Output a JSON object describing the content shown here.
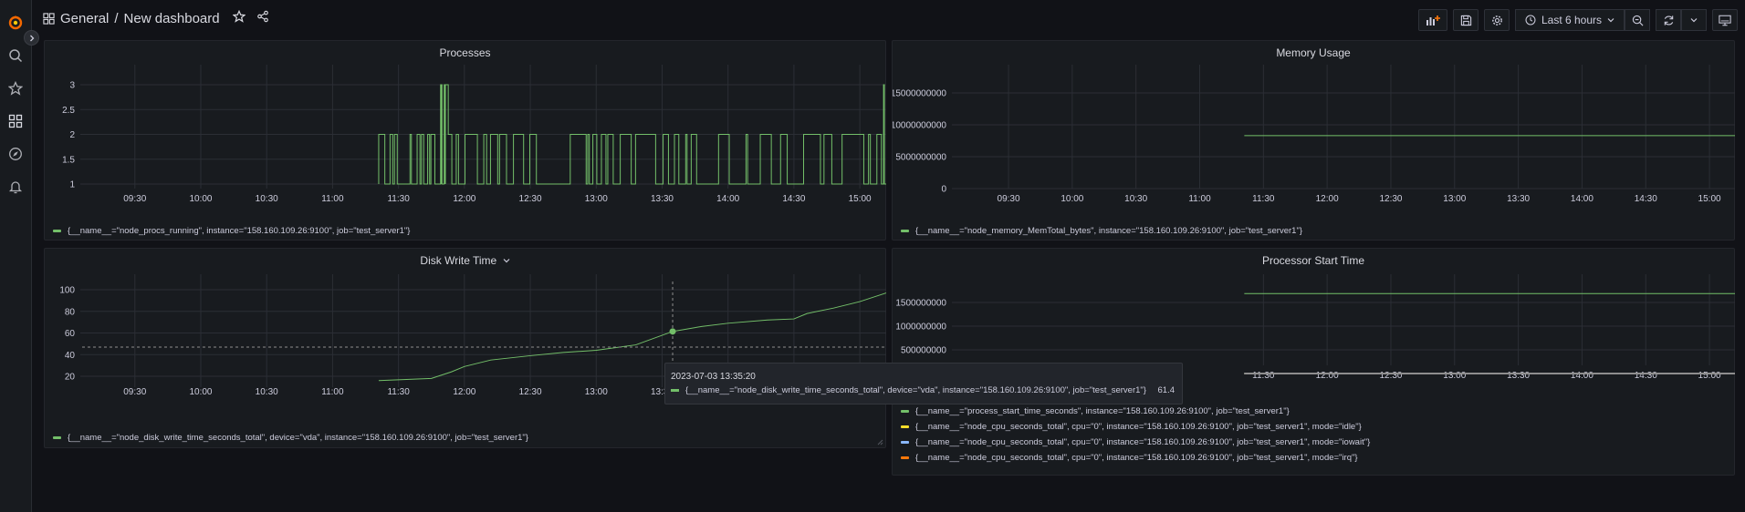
{
  "breadcrumb": {
    "folder": "General",
    "separator": "/",
    "title": "New dashboard"
  },
  "toolbar": {
    "time_range": "Last 6 hours"
  },
  "colors": {
    "series_green": "#73bf69",
    "series_yellow": "#fade2a",
    "series_blue": "#8ab8ff",
    "series_orange": "#ff780a",
    "grid": "#2b2e35",
    "axis_text": "#ccccdc"
  },
  "panels": {
    "processes": {
      "title": "Processes",
      "legend": [
        "{__name__=\"node_procs_running\", instance=\"158.160.109.26:9100\", job=\"test_server1\"}"
      ]
    },
    "memory": {
      "title": "Memory Usage",
      "legend": [
        "{__name__=\"node_memory_MemTotal_bytes\", instance=\"158.160.109.26:9100\", job=\"test_server1\"}"
      ]
    },
    "disk": {
      "title": "Disk Write Time",
      "legend": [
        "{__name__=\"node_disk_write_time_seconds_total\", device=\"vda\", instance=\"158.160.109.26:9100\", job=\"test_server1\"}"
      ],
      "tooltip": {
        "time": "2023-07-03 13:35:20",
        "series": "{__name__=\"node_disk_write_time_seconds_total\", device=\"vda\", instance=\"158.160.109.26:9100\", job=\"test_server1\"}",
        "value": "61.4"
      }
    },
    "processor": {
      "title": "Processor Start Time",
      "legend": [
        "{__name__=\"process_start_time_seconds\", instance=\"158.160.109.26:9100\", job=\"test_server1\"}",
        "{__name__=\"node_cpu_seconds_total\", cpu=\"0\", instance=\"158.160.109.26:9100\", job=\"test_server1\", mode=\"idle\"}",
        "{__name__=\"node_cpu_seconds_total\", cpu=\"0\", instance=\"158.160.109.26:9100\", job=\"test_server1\", mode=\"iowait\"}",
        "{__name__=\"node_cpu_seconds_total\", cpu=\"0\", instance=\"158.160.109.26:9100\", job=\"test_server1\", mode=\"irq\"}"
      ]
    }
  },
  "chart_data": [
    {
      "type": "line",
      "title": "Processes",
      "x_ticks": [
        "09:30",
        "10:00",
        "10:30",
        "11:00",
        "11:30",
        "12:00",
        "12:30",
        "13:00",
        "13:30",
        "14:00",
        "14:30",
        "15:00"
      ],
      "y_ticks": [
        "1",
        "1.5",
        "2",
        "2.5",
        "3"
      ],
      "ylim": [
        1,
        3
      ],
      "xlim_hours": [
        9.1,
        15.2
      ],
      "series": [
        {
          "name": "{__name__=\"node_procs_running\", instance=\"158.160.109.26:9100\", job=\"test_server1\"}",
          "x": [
            11.35,
            11.35,
            15.2,
            15.2
          ],
          "values": [
            1,
            2,
            2,
            1
          ],
          "spikes_to_3": [
            11.82,
            11.85,
            15.18
          ]
        }
      ]
    },
    {
      "type": "line",
      "title": "Memory Usage",
      "x_ticks": [
        "09:30",
        "10:00",
        "10:30",
        "11:00",
        "11:30",
        "12:00",
        "12:30",
        "13:00",
        "13:30",
        "14:00",
        "14:30",
        "15:00"
      ],
      "y_ticks": [
        "0",
        "5000000000",
        "10000000000",
        "15000000000"
      ],
      "ylim": [
        0,
        15000000000
      ],
      "series": [
        {
          "name": "{__name__=\"node_memory_MemTotal_bytes\", instance=\"158.160.109.26:9100\", job=\"test_server1\"}",
          "x": [
            11.35,
            15.2
          ],
          "values": [
            8300000000,
            8300000000
          ]
        }
      ]
    },
    {
      "type": "line",
      "title": "Disk Write Time",
      "x_ticks": [
        "09:30",
        "10:00",
        "10:30",
        "11:00",
        "11:30",
        "12:00",
        "12:30",
        "13:00",
        "13:30",
        "14:00",
        "14:30",
        "15:00"
      ],
      "y_ticks": [
        "20",
        "40",
        "60",
        "80",
        "100"
      ],
      "ylim": [
        10,
        105
      ],
      "series": [
        {
          "name": "{__name__=\"node_disk_write_time_seconds_total\", device=\"vda\", instance=\"158.160.109.26:9100\", job=\"test_server1\"}",
          "x": [
            11.35,
            11.75,
            11.9,
            12.0,
            12.2,
            12.5,
            12.75,
            13.0,
            13.3,
            13.58,
            13.8,
            14.0,
            14.3,
            14.5,
            14.6,
            14.8,
            15.0,
            15.2
          ],
          "values": [
            16,
            18,
            24,
            29,
            35,
            39,
            42,
            44,
            49,
            61.4,
            66,
            69,
            72,
            73,
            78,
            83,
            89,
            97
          ]
        }
      ]
    },
    {
      "type": "line",
      "title": "Processor Start Time",
      "x_ticks": [
        "11:30",
        "12:00",
        "12:30",
        "13:00",
        "13:30",
        "14:00",
        "14:30",
        "15:00"
      ],
      "y_ticks": [
        "500000000",
        "1000000000",
        "1500000000"
      ],
      "ylim": [
        0,
        1900000000
      ],
      "series": [
        {
          "name": "{__name__=\"process_start_time_seconds\", instance=\"158.160.109.26:9100\", job=\"test_server1\"}",
          "x": [
            11.35,
            15.2
          ],
          "values": [
            1688370000,
            1688370000
          ]
        },
        {
          "name": "{__name__=\"node_cpu_seconds_total\", cpu=\"0\", instance=\"158.160.109.26:9100\", job=\"test_server1\", mode=\"idle\"}",
          "x": [
            11.35,
            15.2
          ],
          "values": [
            20000,
            40000
          ]
        },
        {
          "name": "{__name__=\"node_cpu_seconds_total\", cpu=\"0\", instance=\"158.160.109.26:9100\", job=\"test_server1\", mode=\"iowait\"}",
          "x": [
            11.35,
            15.2
          ],
          "values": [
            100,
            200
          ]
        },
        {
          "name": "{__name__=\"node_cpu_seconds_total\", cpu=\"0\", instance=\"158.160.109.26:9100\", job=\"test_server1\", mode=\"irq\"}",
          "x": [
            11.35,
            15.2
          ],
          "values": [
            0,
            0
          ]
        }
      ]
    }
  ]
}
